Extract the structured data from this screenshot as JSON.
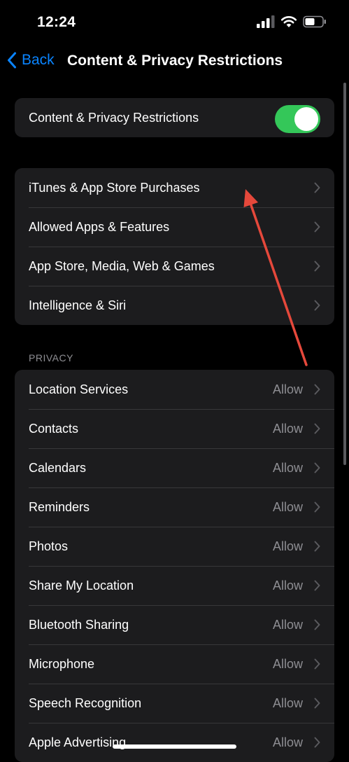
{
  "status_bar": {
    "time": "12:24"
  },
  "nav": {
    "back_label": "Back",
    "title": "Content & Privacy Restrictions"
  },
  "main_toggle": {
    "label": "Content & Privacy Restrictions",
    "on": true
  },
  "group1": {
    "items": [
      {
        "label": "iTunes & App Store Purchases"
      },
      {
        "label": "Allowed Apps & Features"
      },
      {
        "label": "App Store, Media, Web & Games"
      },
      {
        "label": "Intelligence & Siri"
      }
    ]
  },
  "privacy": {
    "header": "PRIVACY",
    "items": [
      {
        "label": "Location Services",
        "value": "Allow"
      },
      {
        "label": "Contacts",
        "value": "Allow"
      },
      {
        "label": "Calendars",
        "value": "Allow"
      },
      {
        "label": "Reminders",
        "value": "Allow"
      },
      {
        "label": "Photos",
        "value": "Allow"
      },
      {
        "label": "Share My Location",
        "value": "Allow"
      },
      {
        "label": "Bluetooth Sharing",
        "value": "Allow"
      },
      {
        "label": "Microphone",
        "value": "Allow"
      },
      {
        "label": "Speech Recognition",
        "value": "Allow"
      },
      {
        "label": "Apple Advertising",
        "value": "Allow"
      }
    ]
  },
  "colors": {
    "accent": "#0a84ff",
    "toggle_on": "#34c759",
    "annotation_arrow": "#e5483b"
  }
}
